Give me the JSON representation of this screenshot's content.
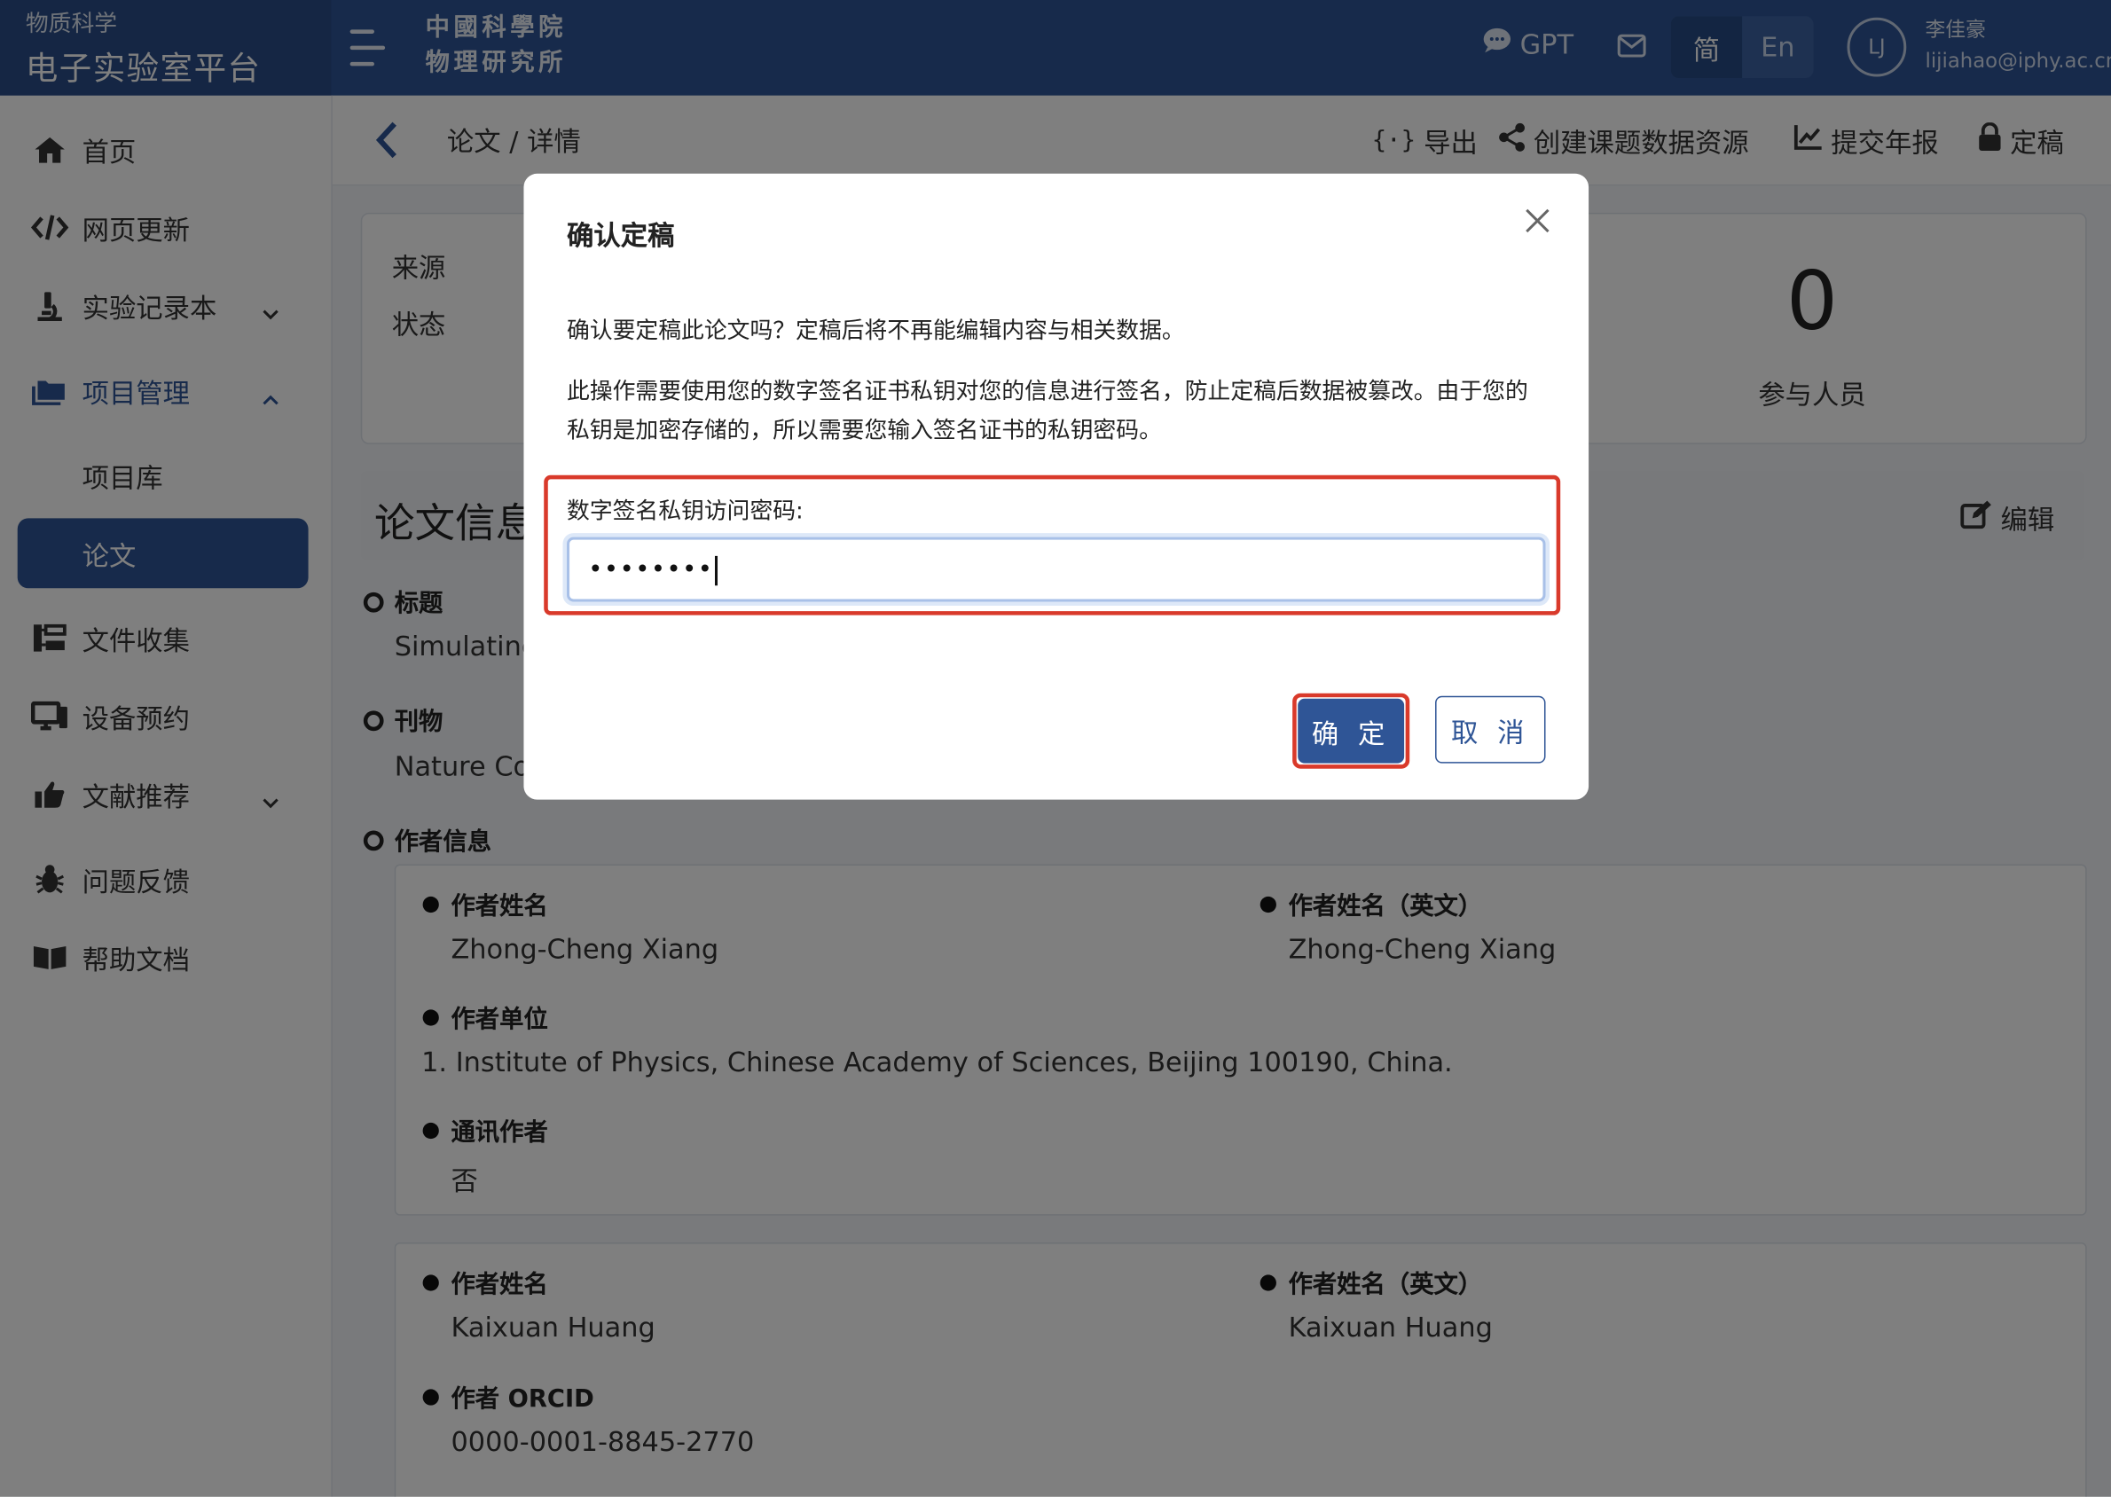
{
  "brand": {
    "sub": "物质科学",
    "main": "电子实验室平台"
  },
  "org": {
    "line1": "中國科學院",
    "line2": "物理研究所"
  },
  "topbar": {
    "gpt_label": "GPT",
    "lang_cn": "简",
    "lang_en": "En",
    "avatar_initials": "LJ",
    "user_name": "李佳豪",
    "user_email": "lijiahao@iphy.ac.cn"
  },
  "sidebar": {
    "items": [
      {
        "label": "首页"
      },
      {
        "label": "网页更新"
      },
      {
        "label": "实验记录本"
      },
      {
        "label": "项目管理"
      },
      {
        "label": "项目库"
      },
      {
        "label": "论文"
      },
      {
        "label": "文件收集"
      },
      {
        "label": "设备预约"
      },
      {
        "label": "文献推荐"
      },
      {
        "label": "问题反馈"
      },
      {
        "label": "帮助文档"
      }
    ]
  },
  "breadcrumb": {
    "text": "论文 / 详情"
  },
  "actions": {
    "export": "导出",
    "create_resource": "创建课题数据资源",
    "submit_report": "提交年报",
    "finalize": "定稿"
  },
  "stats": {
    "source_label": "来源",
    "status_label": "状态",
    "participants_count": "0",
    "participants_label": "参与人员"
  },
  "section": {
    "title": "论文信息",
    "edit": "编辑"
  },
  "fields": {
    "title_label": "标题",
    "title_value": "Simulating",
    "journal_label": "刊物",
    "journal_value": "Nature Co",
    "authors_label": "作者信息"
  },
  "authors": [
    {
      "name_label": "作者姓名",
      "name": "Zhong-Cheng Xiang",
      "name_en_label": "作者姓名（英文）",
      "name_en": "Zhong-Cheng Xiang",
      "unit_label": "作者单位",
      "unit": "1. Institute of Physics, Chinese Academy of Sciences, Beijing 100190, China.",
      "corr_label": "通讯作者",
      "corr": "否"
    },
    {
      "name_label": "作者姓名",
      "name": "Kaixuan Huang",
      "name_en_label": "作者姓名（英文）",
      "name_en": "Kaixuan Huang",
      "orcid_label": "作者 ORCID",
      "orcid": "0000-0001-8845-2770"
    }
  ],
  "modal": {
    "title": "确认定稿",
    "message1": "确认要定稿此论文吗？定稿后将不再能编辑内容与相关数据。",
    "message2": "此操作需要使用您的数字签名证书私钥对您的信息进行签名，防止定稿后数据被篡改。由于您的私钥是加密存储的，所以需要您输入签名证书的私钥密码。",
    "password_label": "数字签名私钥访问密码:",
    "password_value": "••••••••",
    "confirm": "确 定",
    "cancel": "取 消"
  },
  "colors": {
    "primary": "#2f5596",
    "highlight": "#d93a2b"
  }
}
